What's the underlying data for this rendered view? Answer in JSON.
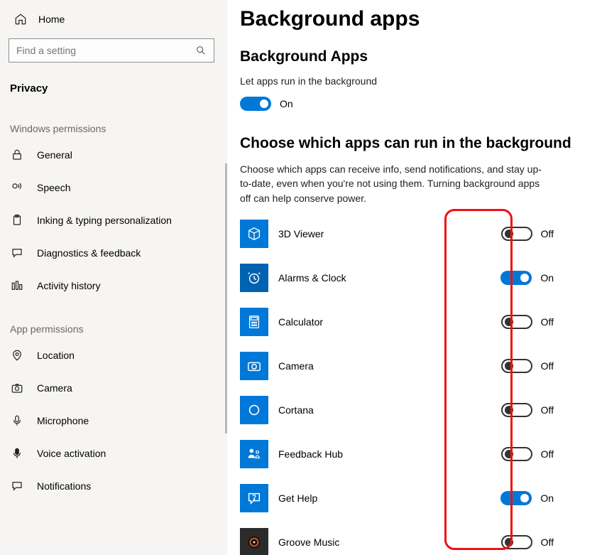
{
  "sidebar": {
    "home": "Home",
    "search_placeholder": "Find a setting",
    "section": "Privacy",
    "group1": "Windows permissions",
    "items1": [
      {
        "label": "General"
      },
      {
        "label": "Speech"
      },
      {
        "label": "Inking & typing personalization"
      },
      {
        "label": "Diagnostics & feedback"
      },
      {
        "label": "Activity history"
      }
    ],
    "group2": "App permissions",
    "items2": [
      {
        "label": "Location"
      },
      {
        "label": "Camera"
      },
      {
        "label": "Microphone"
      },
      {
        "label": "Voice activation"
      },
      {
        "label": "Notifications"
      }
    ]
  },
  "main": {
    "title": "Background apps",
    "h2a": "Background Apps",
    "let_text": "Let apps run in the background",
    "master_state": "On",
    "h2b": "Choose which apps can run in the background",
    "desc": "Choose which apps can receive info, send notifications, and stay up-to-date, even when you're not using them. Turning background apps off can help conserve power.",
    "apps": [
      {
        "name": "3D Viewer",
        "state": "Off"
      },
      {
        "name": "Alarms & Clock",
        "state": "On"
      },
      {
        "name": "Calculator",
        "state": "Off"
      },
      {
        "name": "Camera",
        "state": "Off"
      },
      {
        "name": "Cortana",
        "state": "Off"
      },
      {
        "name": "Feedback Hub",
        "state": "Off"
      },
      {
        "name": "Get Help",
        "state": "On"
      },
      {
        "name": "Groove Music",
        "state": "Off"
      }
    ]
  }
}
